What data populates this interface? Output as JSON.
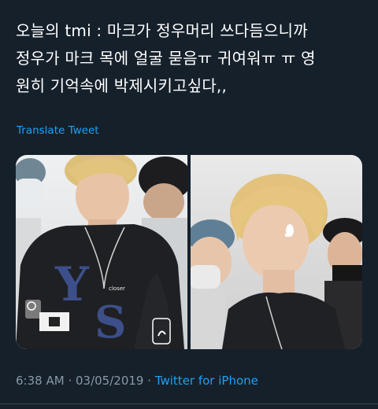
{
  "tweet": {
    "text_lines": [
      "오늘의 tmi : 마크가 정우머리 쓰다듬으니까",
      "정우가 마크 목에 얼굴 묻음ㅠ 귀여워ㅠ ㅠ 영",
      "원히 기억속에 박제시키고싶다,,"
    ],
    "translate_label": "Translate Tweet",
    "time": "6:38 AM",
    "separator": "·",
    "date": "03/05/2019",
    "source": "Twitter for iPhone"
  },
  "media": {
    "left_photo": {
      "shirt_text": "closer",
      "shirt_logo": "NY S"
    }
  },
  "colors": {
    "background": "#15202b",
    "text": "#ffffff",
    "link": "#1da1f2",
    "muted": "#8899a6"
  }
}
